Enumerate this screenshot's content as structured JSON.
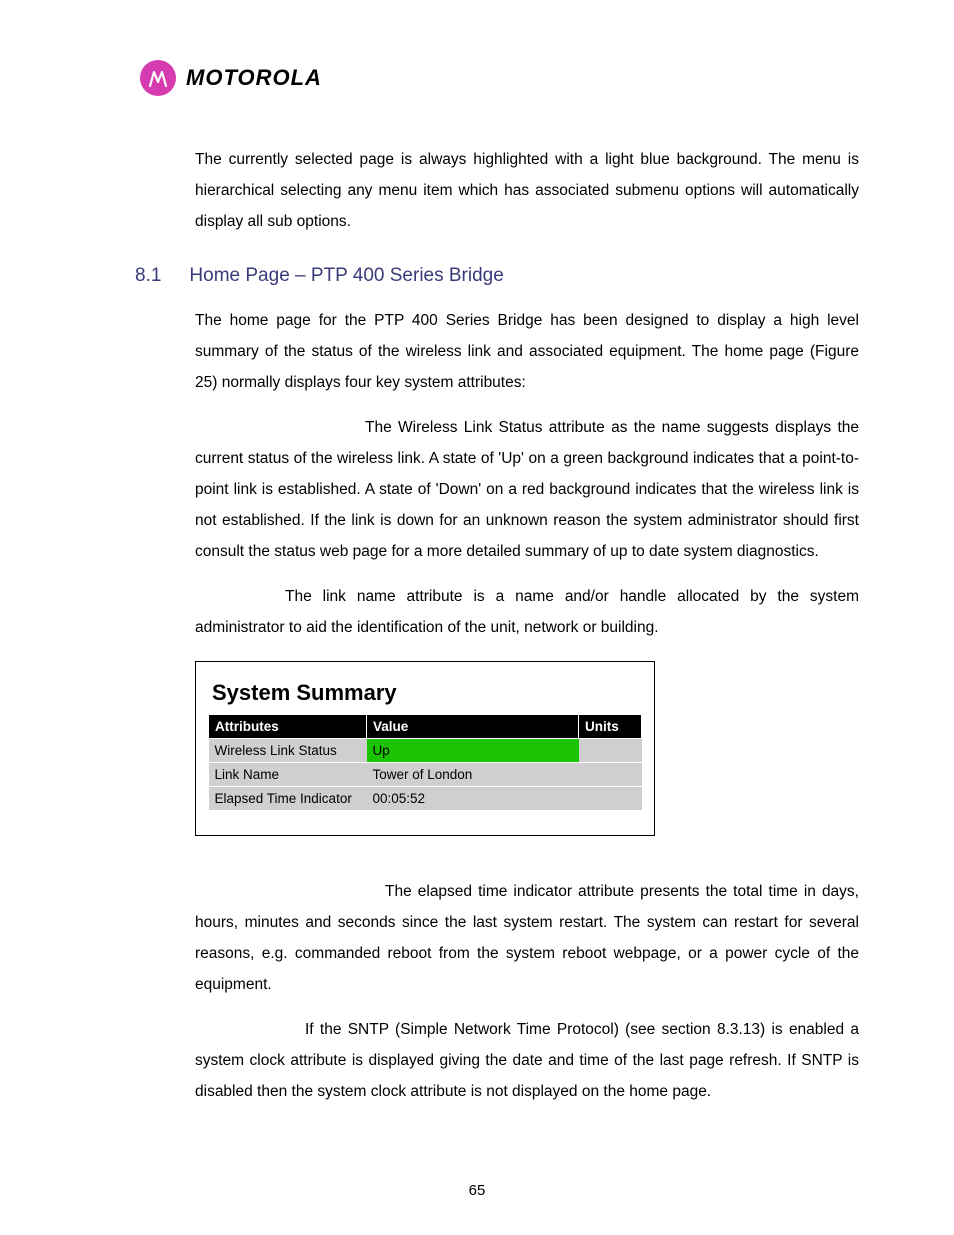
{
  "brand": "MOTOROLA",
  "intro_para": "The currently selected page is always highlighted with a light blue background. The menu is hierarchical selecting any menu item which has associated submenu options will automatically display all sub options.",
  "section": {
    "number": "8.1",
    "title": "Home Page – PTP 400 Series Bridge"
  },
  "para_home": "The home page for the PTP 400 Series Bridge has been designed to display a high level summary of the status of the wireless link and associated equipment. The home page (Figure 25) normally displays four key system attributes:",
  "para_wireless": "The Wireless Link Status attribute as the name suggests displays the current status of the wireless link. A state of 'Up' on a green background indicates that a point-to-point link is established. A state of 'Down' on a red background indicates that the wireless link is not established. If the link is down for an unknown reason the system administrator should first consult the status web page for a more detailed summary of up to date system diagnostics.",
  "para_linkname": "The link name attribute is a name and/or handle allocated by the system administrator to aid the identification of the unit, network or building.",
  "figure": {
    "title": "System Summary",
    "headers": {
      "attr": "Attributes",
      "value": "Value",
      "units": "Units"
    },
    "rows": [
      {
        "attr": "Wireless Link Status",
        "value": "Up",
        "units": "",
        "green": true
      },
      {
        "attr": "Link Name",
        "value": "Tower of London",
        "units": "",
        "green": false
      },
      {
        "attr": "Elapsed Time Indicator",
        "value": "00:05:52",
        "units": "",
        "green": false
      }
    ]
  },
  "para_elapsed": "The elapsed time indicator attribute presents the total time in days, hours, minutes and seconds since the last system restart. The system can restart for several reasons, e.g. commanded reboot from the system reboot webpage, or a power cycle of the equipment.",
  "para_sntp": "If the SNTP (Simple Network Time Protocol) (see section 8.3.13) is enabled a system clock attribute is displayed giving the date and time of the last page refresh. If SNTP is disabled then the system clock attribute is not displayed on the home page.",
  "page_number": "65"
}
